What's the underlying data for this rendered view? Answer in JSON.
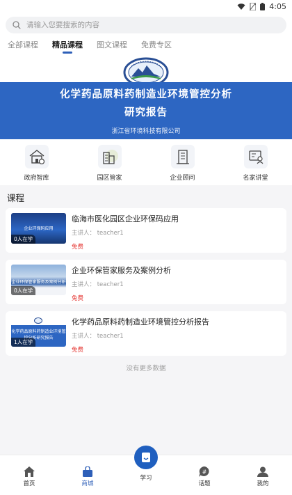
{
  "status": {
    "time": "4:05"
  },
  "search": {
    "placeholder": "请输入您要搜索的内容"
  },
  "tabs": [
    {
      "label": "全部课程",
      "active": false
    },
    {
      "label": "精品课程",
      "active": true
    },
    {
      "label": "图文课程",
      "active": false
    },
    {
      "label": "免费专区",
      "active": false
    }
  ],
  "banner": {
    "title_line1": "化学药品原料药制造业环境管控分析",
    "title_line2": "研究报告",
    "subtitle": "浙江省环境科技有限公司"
  },
  "shortcuts": [
    {
      "label": "政府智库",
      "icon": "gov-house-icon"
    },
    {
      "label": "园区管家",
      "icon": "park-building-icon"
    },
    {
      "label": "企业顾问",
      "icon": "enterprise-building-icon"
    },
    {
      "label": "名家讲堂",
      "icon": "lecture-board-icon"
    }
  ],
  "section_title": "课程",
  "courses": [
    {
      "title": "临海市医化园区企业环保码应用",
      "lecturer_label": "主讲人：",
      "lecturer": "teacher1",
      "price": "免费",
      "learners": "0人在学",
      "thumb_text": "企业环保码应用"
    },
    {
      "title": "企业环保管家服务及案例分析",
      "lecturer_label": "主讲人：",
      "lecturer": "teacher1",
      "price": "免费",
      "learners": "0人在学",
      "thumb_text": "企业环保管家服务及案例分析"
    },
    {
      "title": "化学药品原料药制造业环境管控分析报告",
      "lecturer_label": "主讲人：",
      "lecturer": "teacher1",
      "price": "免费",
      "learners": "1人在学",
      "thumb_text": "化学药品原料药制造业环境管控分析研究报告"
    }
  ],
  "no_more": "没有更多数据",
  "bottom_nav": [
    {
      "label": "首页",
      "icon": "home-icon"
    },
    {
      "label": "商城",
      "icon": "shop-bag-icon",
      "active": true
    },
    {
      "label": "学习",
      "icon": "study-book-icon"
    },
    {
      "label": "话题",
      "icon": "topic-hash-icon"
    },
    {
      "label": "我的",
      "icon": "profile-icon"
    }
  ],
  "colors": {
    "brand_blue": "#2d66c2",
    "price_red": "#e53935"
  }
}
